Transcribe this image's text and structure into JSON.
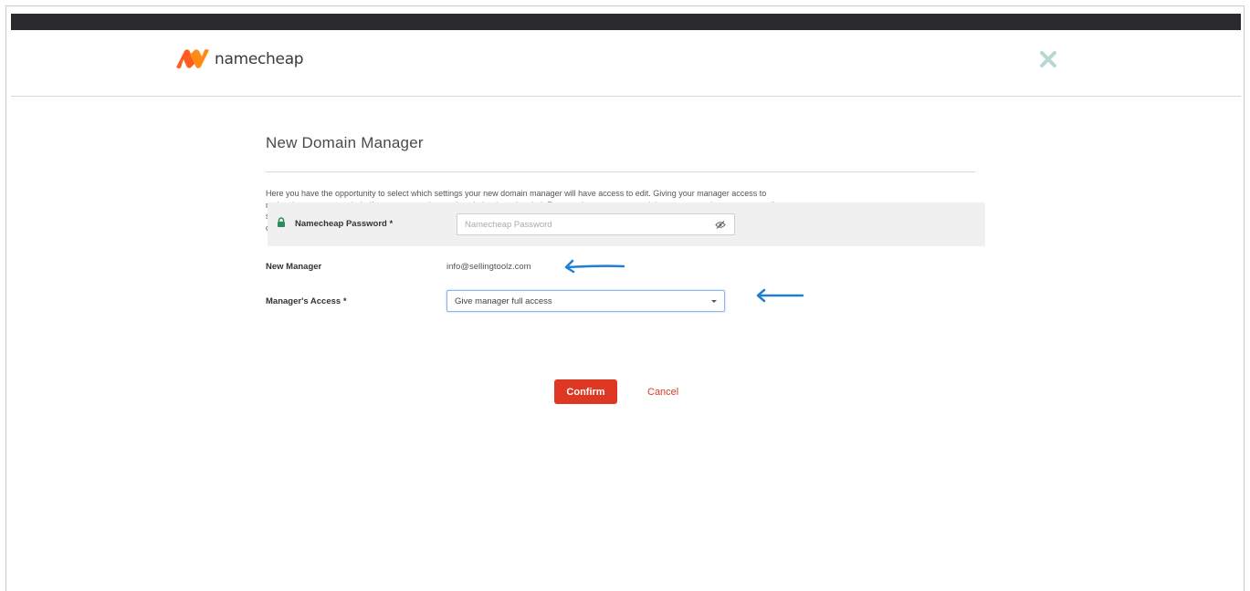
{
  "brand": {
    "name": "namecheap",
    "accent_color": "#de3723",
    "logo_colors": [
      "#ff5a1f",
      "#ff8a16"
    ]
  },
  "dialog": {
    "title": "New Domain Manager",
    "intro": "Here you have the opportunity to select which settings your new domain manager will have access to edit. Giving your manager access to make changes on your behalf can save you time and work, but keep in mind: For security reasons, you might not want to share access to all settings. Enter your account password in the appropriate field to confirm that you wish to share access to these settings with your new domain manager.",
    "fields": {
      "new_manager": {
        "label": "New Manager",
        "value": "info@sellingtoolz.com"
      },
      "access": {
        "label": "Manager's Access *",
        "selected": "Give manager full access"
      },
      "password": {
        "label": "Namecheap Password *",
        "placeholder": "Namecheap Password",
        "value": ""
      }
    },
    "actions": {
      "confirm": "Confirm",
      "cancel": "Cancel"
    }
  },
  "annotations": {
    "arrow_color": "#1f7fd3",
    "icons": [
      "left-arrow-annotation",
      "left-arrow-annotation"
    ]
  },
  "icons": {
    "close": "close-icon",
    "lock": "lock-icon",
    "password_toggle": "eye-slash-icon",
    "select": "chevron-down-icon"
  }
}
